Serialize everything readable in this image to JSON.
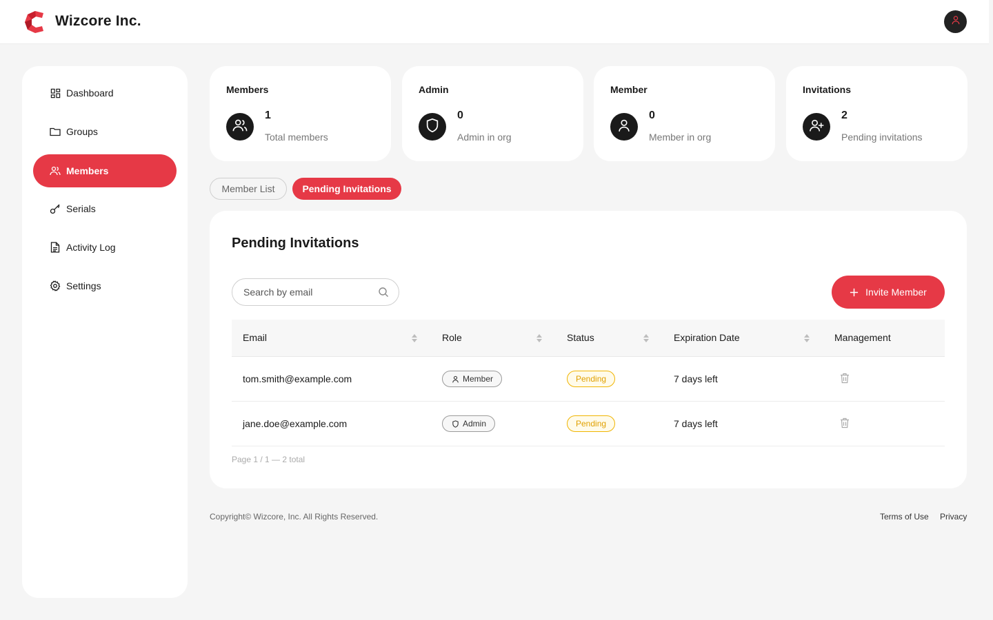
{
  "header": {
    "brand": "Wizcore Inc."
  },
  "sidebar": {
    "items": [
      {
        "label": "Dashboard",
        "icon": "grid-icon"
      },
      {
        "label": "Groups",
        "icon": "folder-icon"
      },
      {
        "label": "Members",
        "icon": "users-icon",
        "active": true
      },
      {
        "label": "Serials",
        "icon": "key-icon"
      },
      {
        "label": "Activity Log",
        "icon": "document-icon"
      },
      {
        "label": "Settings",
        "icon": "gear-icon"
      }
    ]
  },
  "stats": [
    {
      "title": "Members",
      "value": "1",
      "desc": "Total members",
      "icon": "users-icon"
    },
    {
      "title": "Admin",
      "value": "0",
      "desc": "Admin in org",
      "icon": "shield-icon"
    },
    {
      "title": "Member",
      "value": "0",
      "desc": "Member in org",
      "icon": "user-icon"
    },
    {
      "title": "Invitations",
      "value": "2",
      "desc": "Pending invitations",
      "icon": "user-plus-icon"
    }
  ],
  "tabs": {
    "member_list": "Member List",
    "pending": "Pending Invitations"
  },
  "panel": {
    "title": "Pending Invitations",
    "search_placeholder": "Search by email",
    "invite_label": "Invite Member",
    "columns": [
      "Email",
      "Role",
      "Status",
      "Expiration Date",
      "Management"
    ],
    "rows": [
      {
        "email": "tom.smith@example.com",
        "role": "Member",
        "role_icon": "user-icon",
        "status": "Pending",
        "expiration": "7 days left"
      },
      {
        "email": "jane.doe@example.com",
        "role": "Admin",
        "role_icon": "shield-icon",
        "status": "Pending",
        "expiration": "7 days left"
      }
    ],
    "pager": "Page 1 / 1 — 2 total"
  },
  "footer": {
    "copyright": "Copyright© Wizcore, Inc. All Rights Reserved.",
    "terms": "Terms of Use",
    "privacy": "Privacy"
  },
  "colors": {
    "accent": "#e63946",
    "pending": "#f0b400",
    "dark": "#1a1a1a"
  }
}
